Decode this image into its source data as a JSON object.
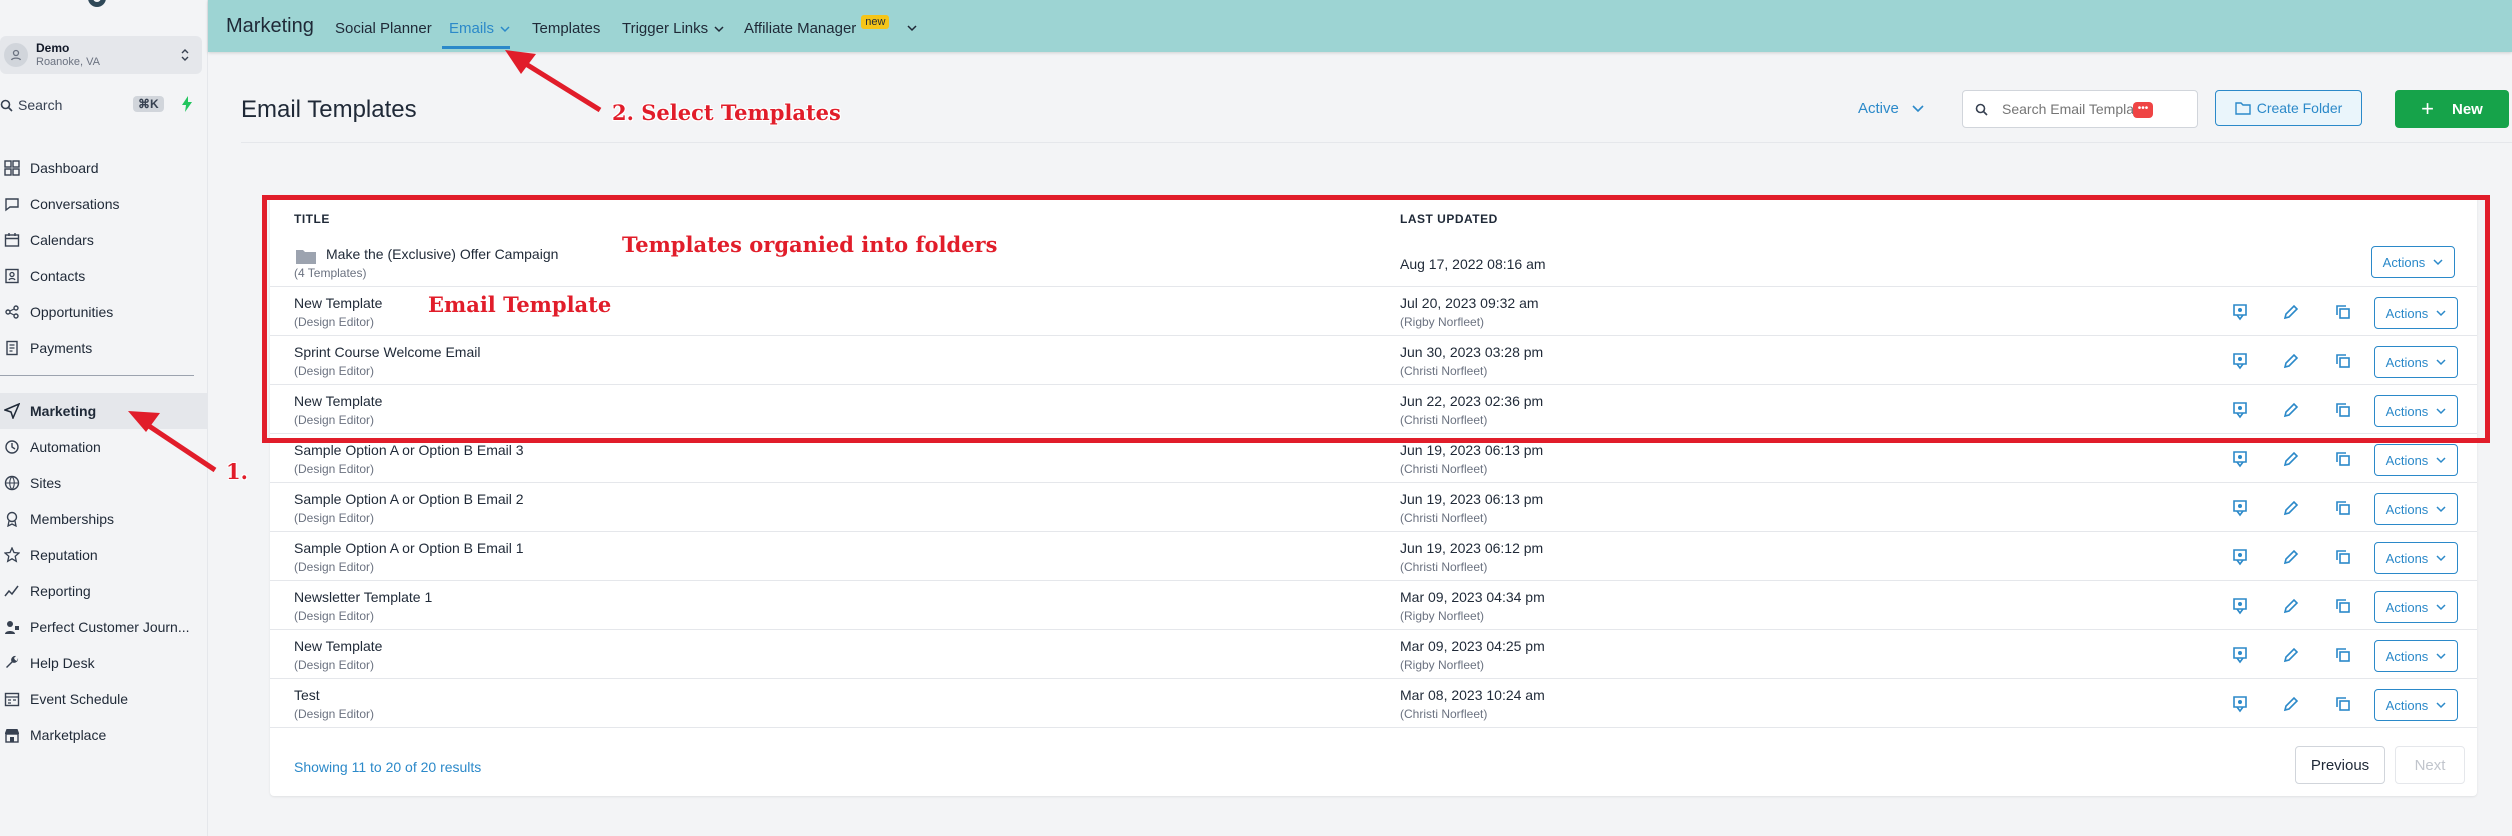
{
  "sidebar": {
    "account_name": "Demo",
    "account_location": "Roanoke, VA",
    "search_label": "Search",
    "search_shortcut": "⌘K",
    "nav_top": [
      {
        "label": "Dashboard",
        "icon": "dashboard-icon"
      },
      {
        "label": "Conversations",
        "icon": "chat-icon"
      },
      {
        "label": "Calendars",
        "icon": "calendar-icon"
      },
      {
        "label": "Contacts",
        "icon": "contacts-icon"
      },
      {
        "label": "Opportunities",
        "icon": "opportunities-icon"
      },
      {
        "label": "Payments",
        "icon": "payments-icon"
      }
    ],
    "nav_bottom": [
      {
        "label": "Marketing",
        "icon": "send-icon",
        "active": true
      },
      {
        "label": "Automation",
        "icon": "automation-icon"
      },
      {
        "label": "Sites",
        "icon": "globe-icon"
      },
      {
        "label": "Memberships",
        "icon": "badge-icon"
      },
      {
        "label": "Reputation",
        "icon": "star-icon"
      },
      {
        "label": "Reporting",
        "icon": "chart-line-icon"
      },
      {
        "label": "Perfect Customer Journ...",
        "icon": "user-group-icon"
      },
      {
        "label": "Help Desk",
        "icon": "wrench-icon"
      },
      {
        "label": "Event Schedule",
        "icon": "schedule-icon"
      },
      {
        "label": "Marketplace",
        "icon": "store-icon"
      }
    ]
  },
  "topbar": {
    "title": "Marketing",
    "tabs": [
      "Social Planner",
      "Emails",
      "Templates",
      "Trigger Links",
      "Affiliate Manager"
    ],
    "new_badge": "new"
  },
  "header": {
    "title": "Email Templates",
    "status_filter": "Active",
    "search_placeholder": "Search Email Templates",
    "create_folder_label": "Create Folder",
    "new_label": "New"
  },
  "table": {
    "columns": [
      "TITLE",
      "LAST UPDATED"
    ],
    "actions_label": "Actions",
    "rows": [
      {
        "title": "Make the (Exclusive) Offer Campaign",
        "sub": "(4 Templates)",
        "date": "Aug 17, 2022 08:16 am",
        "by": "",
        "folder": true
      },
      {
        "title": "New Template",
        "sub": "(Design Editor)",
        "date": "Jul 20, 2023 09:32 am",
        "by": "(Rigby Norfleet)"
      },
      {
        "title": "Sprint Course Welcome Email",
        "sub": "(Design Editor)",
        "date": "Jun 30, 2023 03:28 pm",
        "by": "(Christi Norfleet)"
      },
      {
        "title": "New Template",
        "sub": "(Design Editor)",
        "date": "Jun 22, 2023 02:36 pm",
        "by": "(Christi Norfleet)"
      },
      {
        "title": "Sample Option A or Option B Email 3",
        "sub": "(Design Editor)",
        "date": "Jun 19, 2023 06:13 pm",
        "by": "(Christi Norfleet)"
      },
      {
        "title": "Sample Option A or Option B Email 2",
        "sub": "(Design Editor)",
        "date": "Jun 19, 2023 06:13 pm",
        "by": "(Christi Norfleet)"
      },
      {
        "title": "Sample Option A or Option B Email 1",
        "sub": "(Design Editor)",
        "date": "Jun 19, 2023 06:12 pm",
        "by": "(Christi Norfleet)"
      },
      {
        "title": "Newsletter Template 1",
        "sub": "(Design Editor)",
        "date": "Mar 09, 2023 04:34 pm",
        "by": "(Rigby Norfleet)"
      },
      {
        "title": "New Template",
        "sub": "(Design Editor)",
        "date": "Mar 09, 2023 04:25 pm",
        "by": "(Rigby Norfleet)"
      },
      {
        "title": "Test",
        "sub": "(Design Editor)",
        "date": "Mar 08, 2023 10:24 am",
        "by": "(Christi Norfleet)"
      }
    ],
    "footer_text": "Showing 11 to 20 of 20 results",
    "prev_label": "Previous",
    "next_label": "Next"
  },
  "annotations": {
    "step1": "1.",
    "step2": "2. Select Templates",
    "folders_note": "Templates organied into folders",
    "email_template_note": "Email Template"
  },
  "colors": {
    "topbar": "#9dd4d3",
    "accent": "#2b89c9",
    "new_button": "#16a34a",
    "annotation": "#e11d2a"
  }
}
